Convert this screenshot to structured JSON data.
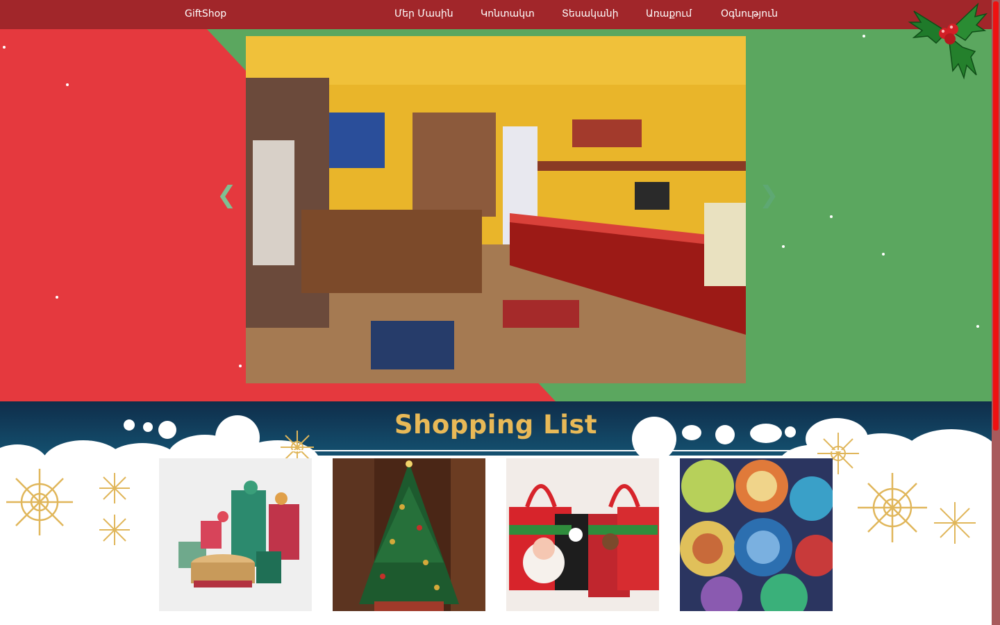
{
  "nav": {
    "brand": "GiftShop",
    "links": [
      "Մեր Մասին",
      "Կոնտակտ",
      "Տեսականի",
      "Առաքում",
      "Օգնություն"
    ]
  },
  "hero": {
    "prev_arrow": "❮",
    "next_arrow": "❯"
  },
  "shopping": {
    "title": "Shopping List",
    "thumbnails": [
      "gift-boxes",
      "christmas-tree",
      "christmas-gift-bags",
      "decorative-plates"
    ]
  },
  "colors": {
    "nav": "#a1262a",
    "hero_red": "#e5393e",
    "hero_green": "#5ba75f",
    "banner_navy": "#0f2d4a",
    "title_gold": "#e8b957",
    "scrollbar_thumb": "#ee1111"
  }
}
